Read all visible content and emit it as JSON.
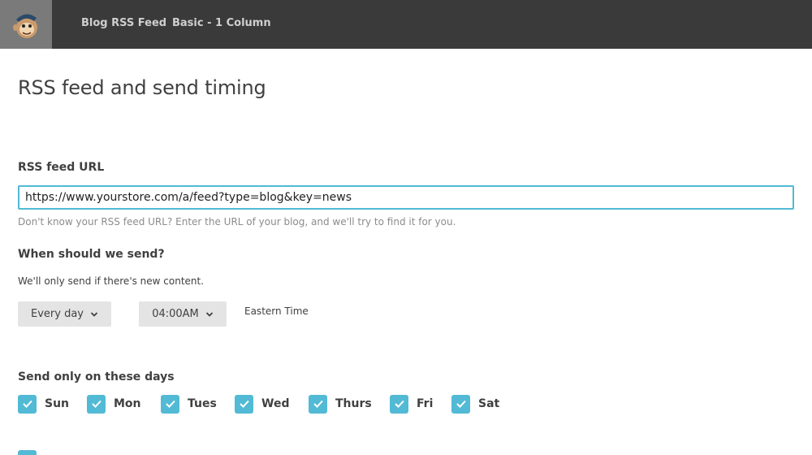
{
  "header": {
    "logo_icon": "chimp-logo-icon",
    "breadcrumbs": [
      "Blog RSS Feed",
      "Basic - 1 Column"
    ]
  },
  "page": {
    "title": "RSS feed and send timing"
  },
  "rss_url": {
    "label": "RSS feed URL",
    "value": "https://www.yourstore.com/a/feed?type=blog&key=news",
    "help": "Don't know your RSS feed URL? Enter the URL of your blog, and we'll try to find it for you."
  },
  "schedule": {
    "label": "When should we send?",
    "note": "We'll only send if there's new content.",
    "frequency": "Every day",
    "time": "04:00AM",
    "timezone": "Eastern Time"
  },
  "days": {
    "label": "Send only on these days",
    "items": [
      {
        "label": "Sun",
        "checked": true
      },
      {
        "label": "Mon",
        "checked": true
      },
      {
        "label": "Tues",
        "checked": true
      },
      {
        "label": "Wed",
        "checked": true
      },
      {
        "label": "Thurs",
        "checked": true
      },
      {
        "label": "Fri",
        "checked": true
      },
      {
        "label": "Sat",
        "checked": true
      }
    ]
  },
  "colors": {
    "topbar": "#3a3a3a",
    "accent": "#52bad5",
    "select_bg": "#e4e4e4"
  }
}
